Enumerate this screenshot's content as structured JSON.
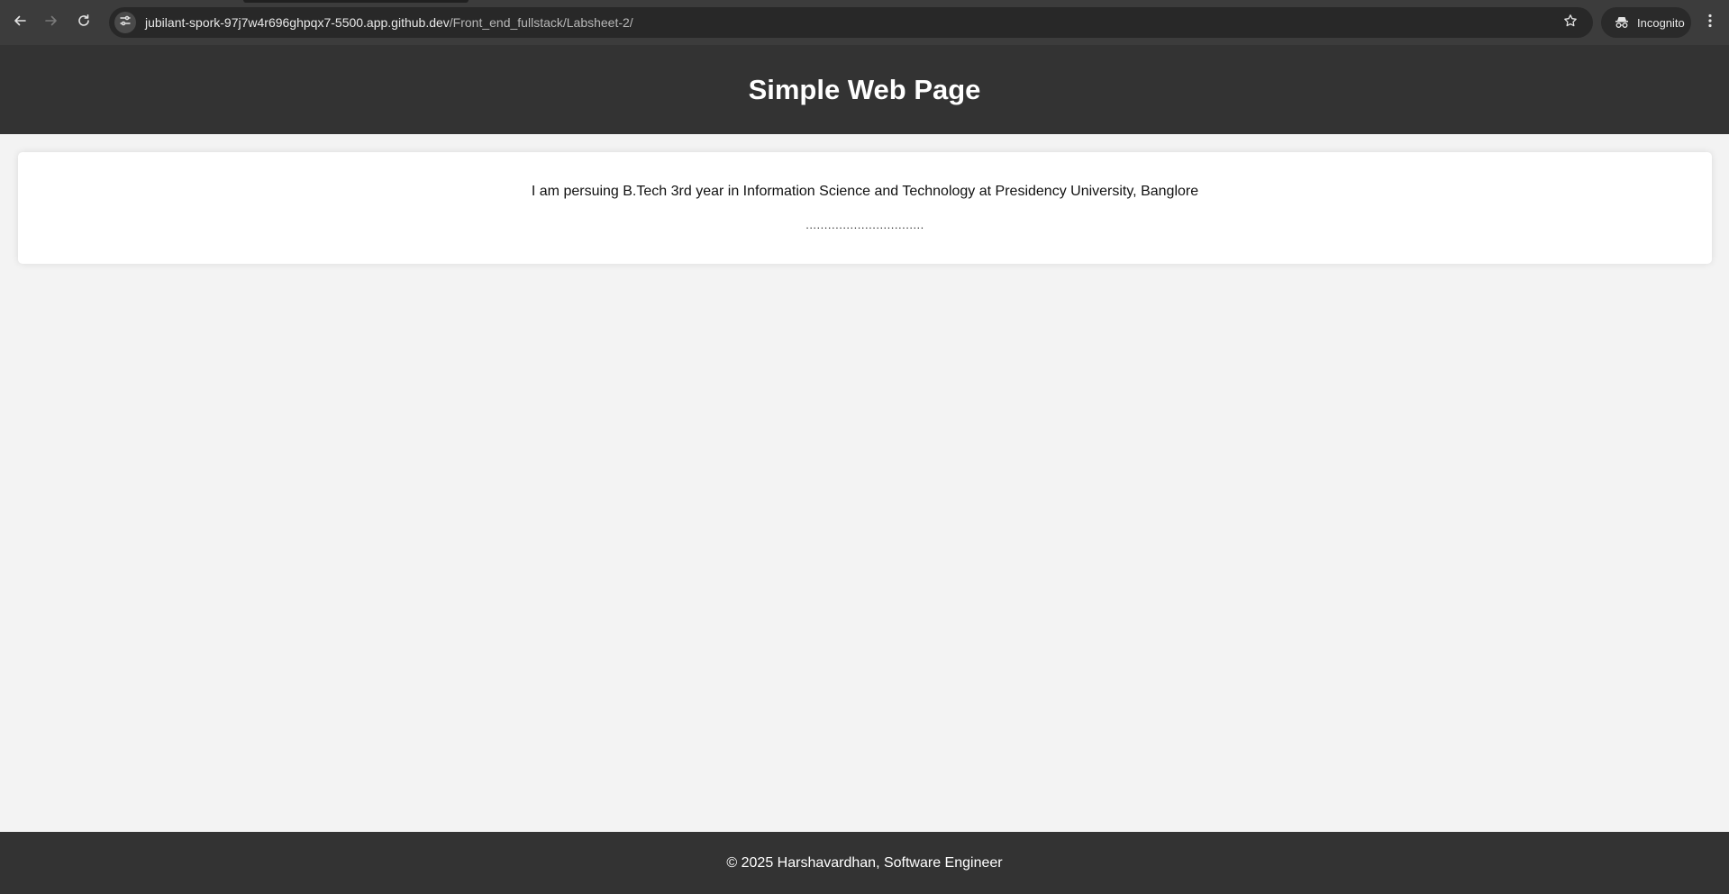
{
  "browser": {
    "url_host": "jubilant-spork-97j7w4r696ghpqx7-5500.app.github.dev",
    "url_path": "/Front_end_fullstack/Labsheet-2/",
    "profile_label": "Incognito",
    "icons": {
      "back": "arrow-left-icon",
      "forward": "arrow-right-icon",
      "reload": "reload-icon",
      "site_info": "tune-icon",
      "bookmark": "star-icon",
      "profile": "incognito-icon",
      "menu": "kebab-menu-icon"
    }
  },
  "header": {
    "title": "Simple Web Page"
  },
  "main": {
    "intro": "I am persuing B.Tech 3rd year in Information Science and Technology at Presidency University, Banglore",
    "dots": "................................"
  },
  "footer": {
    "text": "© 2025 Harshavardhan, Software Engineer"
  },
  "colors": {
    "header_bg": "#333333",
    "page_bg": "#f3f3f3",
    "card_bg": "#ffffff",
    "chrome_bg": "#3c3c3c"
  }
}
